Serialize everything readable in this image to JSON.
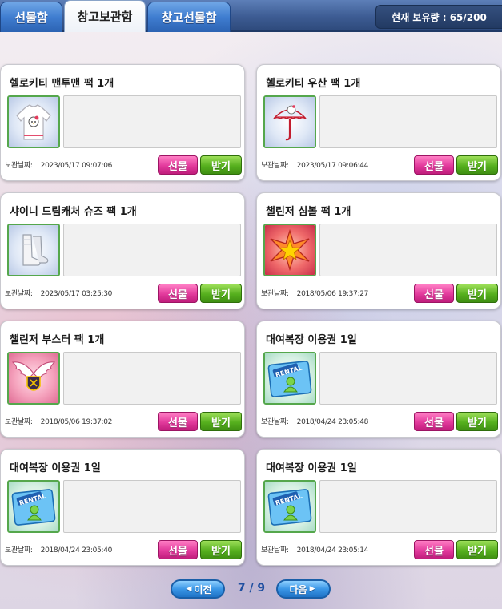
{
  "tabs": [
    {
      "label": "선물함",
      "active": false
    },
    {
      "label": "창고보관함",
      "active": true
    },
    {
      "label": "창고선물함",
      "active": false
    }
  ],
  "capacity": "현재 보유량 : 65/200",
  "date_prefix": "보관날짜:",
  "buttons": {
    "gift": "선물",
    "receive": "받기"
  },
  "items": [
    {
      "title": "헬로키티 맨투맨 팩 1개",
      "date": "2023/05/17 09:07:06",
      "icon": "sweatshirt-icon"
    },
    {
      "title": "헬로키티 우산 팩 1개",
      "date": "2023/05/17 09:06:44",
      "icon": "umbrella-icon"
    },
    {
      "title": "샤이니 드림캐처 슈즈 팩 1개",
      "date": "2023/05/17 03:25:30",
      "icon": "boots-icon"
    },
    {
      "title": "챌린저 심볼 팩 1개",
      "date": "2018/05/06 19:37:27",
      "icon": "star-emblem-icon"
    },
    {
      "title": "챌린저 부스터 팩 1개",
      "date": "2018/05/06 19:37:02",
      "icon": "winged-badge-icon"
    },
    {
      "title": "대여복장 이용권 1일",
      "date": "2018/04/24 23:05:48",
      "icon": "rental-ticket-icon"
    },
    {
      "title": "대여복장 이용권 1일",
      "date": "2018/04/24 23:05:40",
      "icon": "rental-ticket-icon"
    },
    {
      "title": "대여복장 이용권 1일",
      "date": "2018/04/24 23:05:14",
      "icon": "rental-ticket-icon"
    }
  ],
  "rental_text": "RENTAL",
  "pager": {
    "prev": "이전",
    "next": "다음",
    "current": "7 / 9"
  },
  "colors": {
    "gift_button": "#e23a9c",
    "receive_button": "#56b01e",
    "pager": "#3a96e6",
    "header": "#3d5c93"
  }
}
